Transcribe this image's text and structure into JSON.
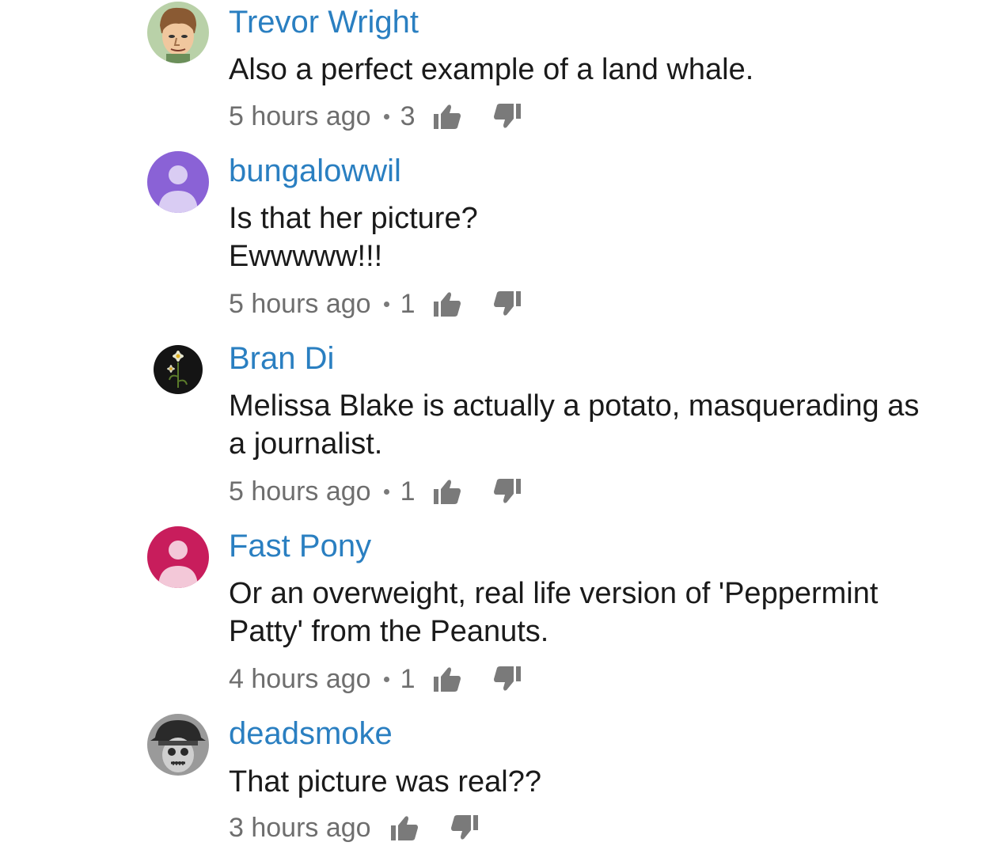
{
  "colors": {
    "author": "#2a7fc1",
    "meta": "#6e6e6e",
    "text": "#1a1a1a",
    "avatar_purple": "#8a62d6",
    "avatar_magenta": "#c81d5c"
  },
  "comments": [
    {
      "author": "Trevor Wright",
      "avatar": "cartoon-face-avatar",
      "text": [
        "Also a perfect example of a land whale."
      ],
      "time": "5 hours ago",
      "likes": "3"
    },
    {
      "author": "bungalowwil",
      "avatar": "default-person-avatar-purple",
      "text": [
        "Is that her picture?",
        "Ewwwww!!!"
      ],
      "time": "5 hours ago",
      "likes": "1"
    },
    {
      "author": "Bran Di",
      "avatar": "flower-photo-avatar",
      "text": [
        "Melissa Blake is actually a potato, masquerading as",
        "a journalist."
      ],
      "time": "5 hours ago",
      "likes": "1"
    },
    {
      "author": "Fast Pony",
      "avatar": "default-person-avatar-magenta",
      "text": [
        "Or an overweight, real life version of 'Peppermint",
        "Patty' from the Peanuts."
      ],
      "time": "4 hours ago",
      "likes": "1"
    },
    {
      "author": "deadsmoke",
      "avatar": "skull-photo-avatar",
      "text": [
        "That picture was real??"
      ],
      "time": "3 hours ago",
      "likes": ""
    }
  ],
  "icons": {
    "like": "thumbs-up-icon",
    "dislike": "thumbs-down-icon"
  }
}
